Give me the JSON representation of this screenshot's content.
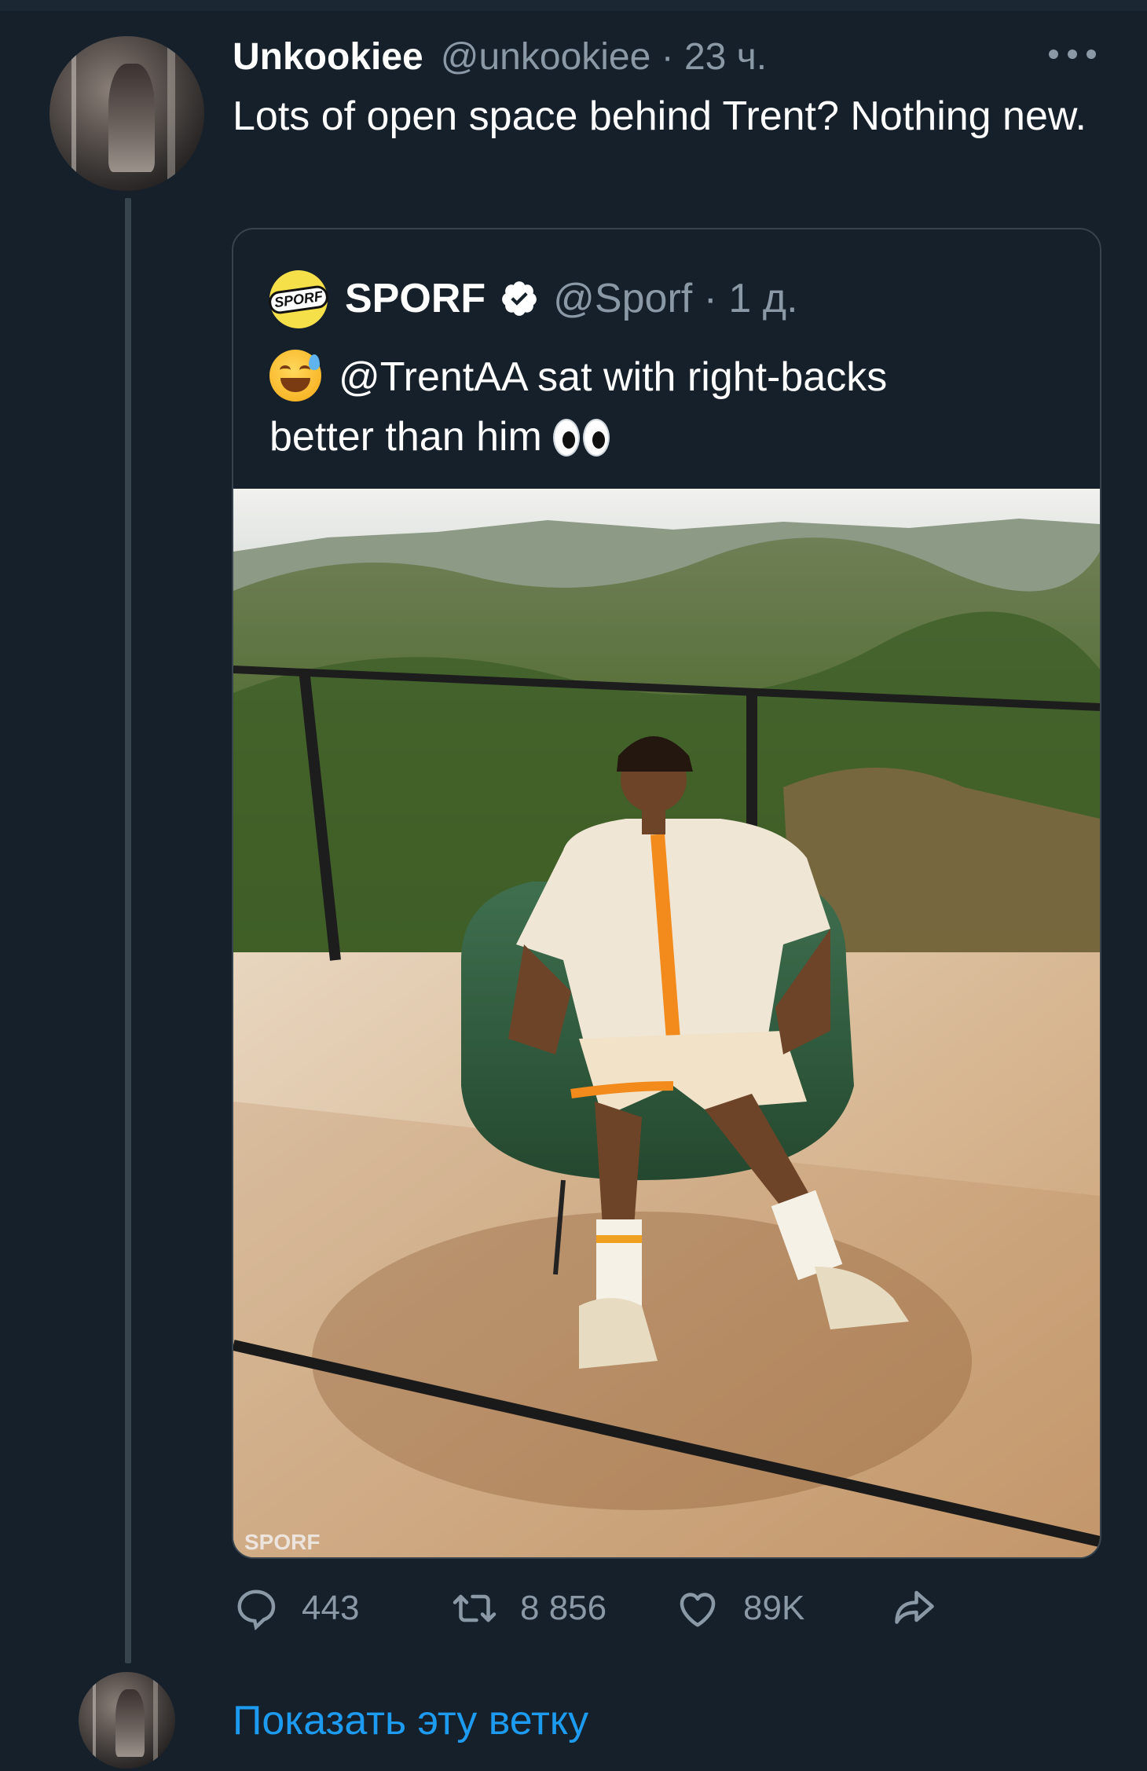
{
  "tweet": {
    "author_name": "Unkookiee",
    "author_handle": "@unkookiee · 23 ч.",
    "text": "Lots of open space behind Trent? Nothing new."
  },
  "quoted_tweet": {
    "author_name": "SPORF",
    "author_handle": "@Sporf · 1 д.",
    "logo_text": "SPORF",
    "text_line1": "@TrentAA sat with right-backs",
    "text_line2": "better than him",
    "watermark": "SPORF"
  },
  "actions": {
    "replies": "443",
    "retweets": "8 856",
    "likes": "89K"
  },
  "show_thread": "Показать эту ветку",
  "colors": {
    "background": "#15202b",
    "secondary_text": "#8b98a5",
    "link": "#1d9bf0",
    "border": "#38444d"
  },
  "icons": [
    "more-icon",
    "verified-icon",
    "sweat-smile-emoji",
    "eyes-emoji",
    "reply-icon",
    "retweet-icon",
    "like-icon",
    "share-icon"
  ]
}
